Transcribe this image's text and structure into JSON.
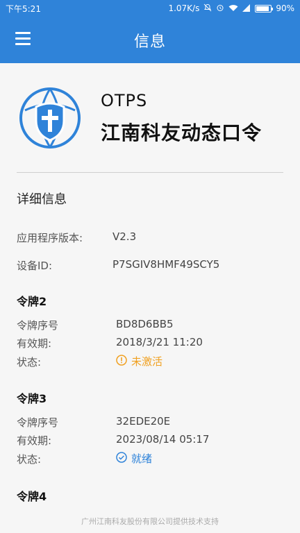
{
  "status_bar": {
    "time": "下午5:21",
    "network_speed": "1.07K/s",
    "battery": "90%",
    "battery_level": 0.9,
    "icons": [
      "mute-bell-icon",
      "alarm-icon",
      "wifi-icon",
      "signal-icon",
      "battery-icon"
    ]
  },
  "app_bar": {
    "title": "信息",
    "menu_icon": "hamburger-menu-icon"
  },
  "header": {
    "app_name": "OTPS",
    "company": "江南科友动态口令",
    "logo_icon": "shield-globe-logo-icon"
  },
  "details": {
    "title": "详细信息",
    "app_version_label": "应用程序版本:",
    "app_version_value": "V2.3",
    "device_id_label": "设备ID:",
    "device_id_value": "P7SGIV8HMF49SCY5"
  },
  "tokens": [
    {
      "title": "令牌2",
      "serial_label": "令牌序号",
      "serial_value": "BD8D6BB5",
      "expiry_label": "有效期:",
      "expiry_value": "2018/3/21 11:20",
      "status_label": "状态:",
      "status_value": "未激活",
      "status_icon": "warning-circle-icon"
    },
    {
      "title": "令牌3",
      "serial_label": "令牌序号",
      "serial_value": "32EDE20E",
      "expiry_label": "有效期:",
      "expiry_value": "2023/08/14 05:17",
      "status_label": "状态:",
      "status_value": "就绪",
      "status_icon": "check-circle-icon"
    },
    {
      "title": "令牌4"
    }
  ],
  "footer": {
    "text": "广州江南科友股份有限公司提供技术支持"
  },
  "colors": {
    "primary": "#2f83d9",
    "warning": "#f0a020",
    "ready": "#2f83d9"
  }
}
